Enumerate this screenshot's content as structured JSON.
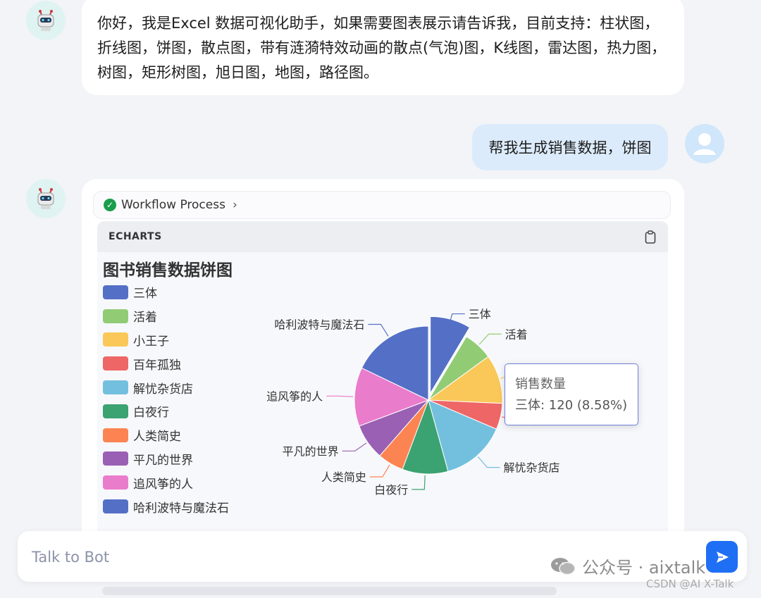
{
  "messages": {
    "bot_intro": "你好，我是Excel 数据可视化助手，如果需要图表展示请告诉我，目前支持：柱状图，折线图，饼图，散点图，带有涟漪特效动画的散点(气泡)图，K线图，雷达图，热力图，树图，矩形树图，旭日图，地图，路径图。",
    "user_request": "帮我生成销售数据，饼图"
  },
  "workflow": {
    "label": "Workflow Process"
  },
  "code_block": {
    "language": "ECHARTS"
  },
  "tooltip": {
    "title": "销售数量",
    "value": "三体: 120 (8.58%)"
  },
  "input": {
    "placeholder": "Talk to Bot"
  },
  "watermark": {
    "text": "公众号 · aixtalk",
    "credit": "CSDN @AI X-Talk"
  },
  "chart_data": {
    "type": "pie",
    "title": "图书销售数据饼图",
    "series_name": "销售数量",
    "legend_position": "left",
    "slices": [
      {
        "name": "三体",
        "value": 120,
        "color": "#5470c6"
      },
      {
        "name": "活着",
        "value": 90,
        "color": "#91cc75"
      },
      {
        "name": "小王子",
        "value": 150,
        "color": "#fac858"
      },
      {
        "name": "百年孤独",
        "value": 80,
        "color": "#ee6666"
      },
      {
        "name": "解忧杂货店",
        "value": 200,
        "color": "#73c0de"
      },
      {
        "name": "白夜行",
        "value": 140,
        "color": "#3ba272"
      },
      {
        "name": "人类简史",
        "value": 80,
        "color": "#fc8452"
      },
      {
        "name": "平凡的世界",
        "value": 110,
        "color": "#9a60b4"
      },
      {
        "name": "追风筝的人",
        "value": 180,
        "color": "#ea7ccc"
      },
      {
        "name": "哈利波特与魔法石",
        "value": 250,
        "color": "#5470c6"
      }
    ],
    "highlighted": "三体"
  }
}
